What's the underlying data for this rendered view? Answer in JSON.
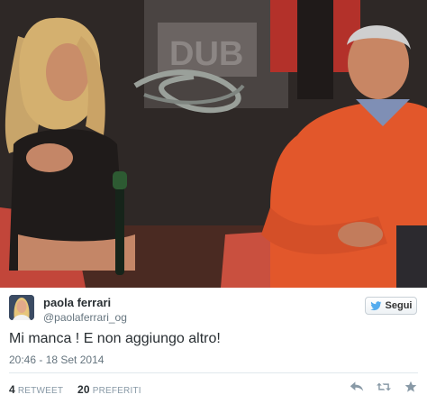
{
  "tweet": {
    "display_name": "paola ferrari",
    "screen_name": "@paolaferrari_og",
    "follow_label": "Segui",
    "text": "Mi manca ! E non aggiungo altro!",
    "timestamp": "20:46 - 18 Set 2014",
    "retweet_count": "4",
    "retweet_label": "RETWEET",
    "favorite_count": "20",
    "favorite_label": "PREFERITI"
  },
  "icons": {
    "follow": "bird-icon",
    "reply": "reply-icon",
    "retweet": "retweet-icon",
    "favorite": "star-icon"
  },
  "colors": {
    "name": "#292f33",
    "secondary_text": "#66757f",
    "action_icon": "#8899a6",
    "bird": "#55acee"
  }
}
